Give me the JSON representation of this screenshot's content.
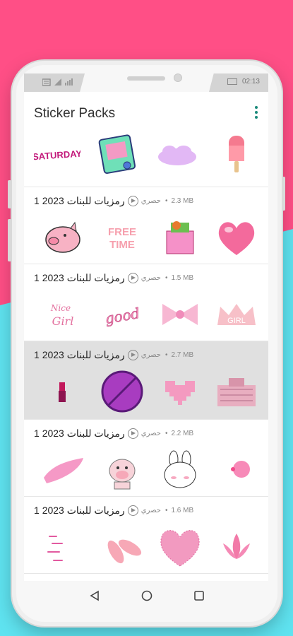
{
  "status": {
    "time": "02:13"
  },
  "app": {
    "title": "Sticker Packs",
    "menu_icon": "more-vert-icon"
  },
  "packs": [
    {
      "name": "رمزيات للبنات 2023 1",
      "author": "حصري",
      "size": "2.3 MB",
      "sticker_icons": [
        "piggy-icon",
        "free-time-text-icon",
        "shopping-bag-icon",
        "pink-heart-icon"
      ]
    },
    {
      "name": "رمزيات للبنات 2023 1",
      "author": "حصري",
      "size": "1.5 MB",
      "sticker_icons": [
        "nice-girl-text-icon",
        "good-text-icon",
        "bow-icon",
        "girl-crown-icon"
      ]
    },
    {
      "name": "رمزيات للبنات 2023 1",
      "author": "حصري",
      "size": "2.7 MB",
      "sticker_icons": [
        "lipstick-icon",
        "purple-prohibited-circle-icon",
        "pixel-heart-icon",
        "pink-building-icon"
      ]
    },
    {
      "name": "رمزيات للبنات 2023 1",
      "author": "حصري",
      "size": "2.2 MB",
      "sticker_icons": [
        "pink-paint-stroke-icon",
        "cute-cow-icon",
        "bunny-icon",
        "bubblegum-icon"
      ]
    },
    {
      "name": "رمزيات للبنات 2023 1",
      "author": "حصري",
      "size": "1.6 MB",
      "sticker_icons": [
        "hearts-text-icon",
        "flip-flops-icon",
        "glitter-heart-icon",
        "lotus-icon"
      ]
    }
  ],
  "top_strip_icons": [
    "saturday-text-icon",
    "calendar-tablet-icon",
    "cloud-text-icon",
    "popsicle-icon"
  ],
  "colors": {
    "brand_pink": "#ff4f86",
    "accent_teal": "#5fe3f0",
    "menu_teal": "#1a8a7a",
    "selected_row": "#e0e0e0"
  },
  "nav": {
    "back": "back-triangle-icon",
    "home": "home-circle-icon",
    "recents": "recents-square-icon"
  }
}
